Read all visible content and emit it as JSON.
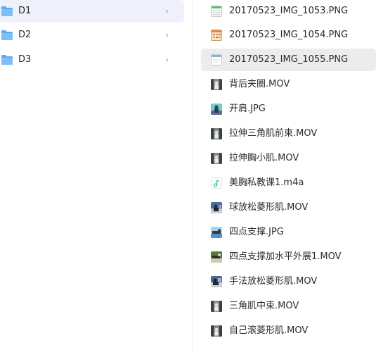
{
  "folders": [
    {
      "label": "D1",
      "selected": true
    },
    {
      "label": "D2",
      "selected": false
    },
    {
      "label": "D3",
      "selected": false
    }
  ],
  "chevron_glyph": "›",
  "files": [
    {
      "label": "20170523_IMG_1053.PNG",
      "icon": "spreadsheet-thumbnail-icon"
    },
    {
      "label": "20170523_IMG_1054.PNG",
      "icon": "calendar-thumbnail-icon"
    },
    {
      "label": "20170523_IMG_1055.PNG",
      "icon": "screenshot-thumbnail-icon"
    },
    {
      "label": "背后夹圈.MOV",
      "icon": "video-thumbnail-icon"
    },
    {
      "label": "开肩.JPG",
      "icon": "photo-thumbnail-icon"
    },
    {
      "label": "拉伸三角肌前束.MOV",
      "icon": "video-thumbnail-icon"
    },
    {
      "label": "拉伸胸小肌.MOV",
      "icon": "video-thumbnail-icon"
    },
    {
      "label": "美胸私教课1.m4a",
      "icon": "audio-note-icon"
    },
    {
      "label": "球放松菱形肌.MOV",
      "icon": "video-thumbnail-icon"
    },
    {
      "label": "四点支撑.JPG",
      "icon": "photo-thumbnail-icon"
    },
    {
      "label": "四点支撑加水平外展1.MOV",
      "icon": "video-thumbnail-icon"
    },
    {
      "label": "手法放松菱形肌.MOV",
      "icon": "video-thumbnail-icon"
    },
    {
      "label": "三角肌中束.MOV",
      "icon": "video-thumbnail-icon"
    },
    {
      "label": "自己滚菱形肌.MOV",
      "icon": "video-thumbnail-icon"
    }
  ],
  "selected_file_index": 2,
  "colors": {
    "folder_selected_bg": "#eef1fb",
    "file_selected_bg": "#ececee",
    "folder_icon": "#5aa9f0",
    "audio_note": "#2fbf8f"
  }
}
